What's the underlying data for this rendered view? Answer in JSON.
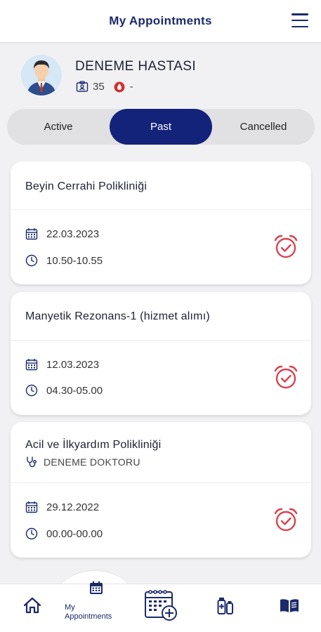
{
  "header": {
    "title": "My Appointments",
    "menu_icon": "hamburger-menu-icon"
  },
  "patient": {
    "name": "DENEME HASTASI",
    "age": "35",
    "blood_type": "-",
    "age_icon": "id-card-icon",
    "blood_icon": "blood-drop-icon"
  },
  "tabs": [
    {
      "label": "Active",
      "selected": false
    },
    {
      "label": "Past",
      "selected": true
    },
    {
      "label": "Cancelled",
      "selected": false
    }
  ],
  "appointments": [
    {
      "department": "Beyin Cerrahi Polikliniği",
      "doctor": "",
      "date": "22.03.2023",
      "time": "10.50-10.55",
      "status_icon": "alarm-check-icon"
    },
    {
      "department": "Manyetik Rezonans-1 (hizmet alımı)",
      "doctor": "",
      "date": "12.03.2023",
      "time": "04.30-05.00",
      "status_icon": "alarm-check-icon"
    },
    {
      "department": "Acil ve İlkyardım Polikliniği",
      "doctor": "DENEME DOKTORU",
      "date": "29.12.2022",
      "time": "00.00-00.00",
      "status_icon": "alarm-check-icon"
    }
  ],
  "bottom_nav": {
    "home_icon": "home-icon",
    "appointments_label": "My\nAppointments",
    "appointments_label_line1": "My",
    "appointments_label_line2": "Appointments",
    "center_icon": "calendar-plus-icon",
    "medicine_icon": "medicine-bottles-icon",
    "book_icon": "book-icon"
  },
  "colors": {
    "primary": "#14237a",
    "alarm": "#d8434f",
    "blood": "#d32f2f"
  }
}
